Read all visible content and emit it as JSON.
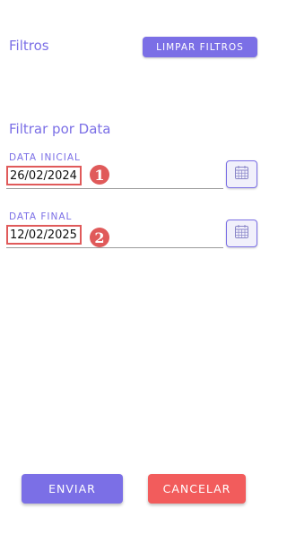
{
  "header": {
    "title": "Filtros",
    "clear_label": "LIMPAR FILTROS"
  },
  "date_filter": {
    "section_title": "Filtrar por Data",
    "start": {
      "label": "DATA INICIAL",
      "value": "26/02/2024",
      "marker": "1"
    },
    "end": {
      "label": "DATA FINAL",
      "value": "12/02/2025",
      "marker": "2"
    },
    "calendar_icon": "calendar-icon"
  },
  "footer": {
    "submit_label": "ENVIAR",
    "cancel_label": "CANCELAR"
  },
  "colors": {
    "accent": "#7b6fe6",
    "danger": "#f25c5c",
    "highlight": "#e05a5a"
  }
}
